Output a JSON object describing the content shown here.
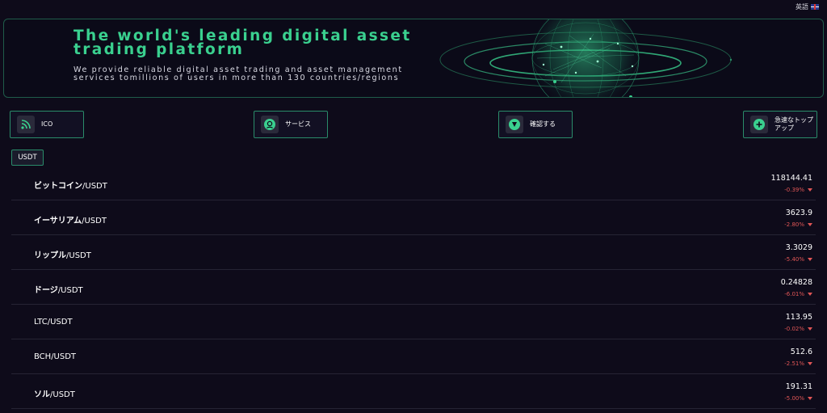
{
  "language": {
    "label": "英語",
    "flag_icon": "uk-flag-icon"
  },
  "banner": {
    "title": "The world's leading digital asset trading platform",
    "subtitle": "We provide reliable digital asset trading and asset management services tomillions of users in more than 130 countries/regions",
    "accent_color": "#3ad08f"
  },
  "actions": [
    {
      "label": "ICO",
      "icon": "rss-icon"
    },
    {
      "label": "サービス",
      "icon": "support-agent-icon"
    },
    {
      "label": "確認する",
      "icon": "shield-check-icon"
    },
    {
      "label": "急速なトップアップ",
      "icon": "plus-circle-icon"
    }
  ],
  "market_tab": {
    "label": "USDT"
  },
  "market": {
    "down_color": "#e05656",
    "rows": [
      {
        "base": "ビットコイン",
        "quote": "/USDT",
        "price": "118144.41",
        "change": "-0.39%"
      },
      {
        "base": "イーサリアム",
        "quote": "/USDT",
        "price": "3623.9",
        "change": "-2.80%"
      },
      {
        "base": "リップル",
        "quote": "/USDT",
        "price": "3.3029",
        "change": "-5.40%"
      },
      {
        "base": "ドージ",
        "quote": "/USDT",
        "price": "0.24828",
        "change": "-6.01%"
      },
      {
        "base": "LTC",
        "quote": "/USDT",
        "price": "113.95",
        "change": "-0.02%"
      },
      {
        "base": "BCH",
        "quote": "/USDT",
        "price": "512.6",
        "change": "-2.51%"
      },
      {
        "base": "ソル",
        "quote": "/USDT",
        "price": "191.31",
        "change": "-5.00%"
      }
    ]
  }
}
